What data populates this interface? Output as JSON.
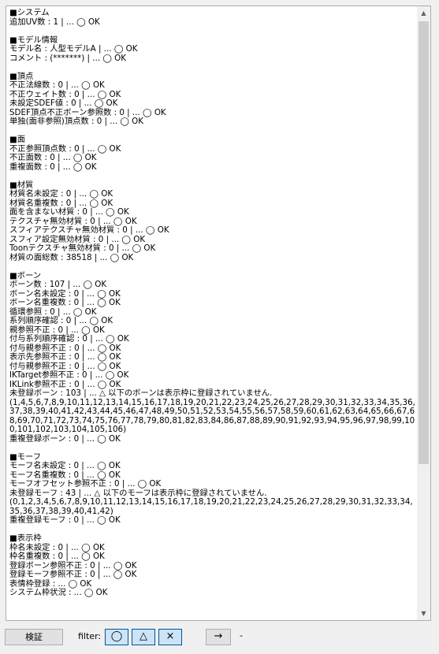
{
  "report": {
    "lines": [
      "■システム",
      "追加UV数 : 1 | ... ◯ OK",
      "",
      "■モデル情報",
      "モデル名 : 人型モデルA | ... ◯ OK",
      "コメント : (*******) | ... ◯ OK",
      "",
      "■頂点",
      "不正法線数 : 0 | ... ◯ OK",
      "不正ウェイト数 : 0 | ... ◯ OK",
      "未設定SDEF値 : 0 | ... ◯ OK",
      "SDEF頂点不正ボーン参照数 : 0 | ... ◯ OK",
      "単独(面非参照)頂点数 : 0 | ... ◯ OK",
      "",
      "■面",
      "不正参照頂点数 : 0 | ... ◯ OK",
      "不正面数 : 0 | ... ◯ OK",
      "重複面数 : 0 | ... ◯ OK",
      "",
      "■材質",
      "材質名未設定 : 0 | ... ◯ OK",
      "材質名重複数 : 0 | ... ◯ OK",
      "面を含まない材質 : 0 | ... ◯ OK",
      "テクスチャ無効材質 : 0 | ... ◯ OK",
      "スフィアテクスチャ無効材質 : 0 | ... ◯ OK",
      "スフィア設定無効材質 : 0 | ... ◯ OK",
      "Toonテクスチャ無効材質 : 0 | ... ◯ OK",
      "材質の面総数 : 38518 | ... ◯ OK",
      "",
      "■ボーン",
      "ボーン数 : 107 | ... ◯ OK",
      "ボーン名未設定 : 0 | ... ◯ OK",
      "ボーン名重複数 : 0 | ... ◯ OK",
      "循環参照 : 0 | ... ◯ OK",
      "系列順序確認 : 0 | ... ◯ OK",
      "親参照不正 : 0 | ... ◯ OK",
      "付与系列順序確認 : 0 | ... ◯ OK",
      "付与親参照不正 : 0 | ... ◯ OK",
      "表示先参照不正 : 0 | ... ◯ OK",
      "付与親参照不正 : 0 | ... ◯ OK",
      "IKTarget参照不正 : 0 | ... ◯ OK",
      "IKLink参照不正 : 0 | ... ◯ OK",
      "未登録ボーン : 103 | ... △ 以下のボーンは表示枠に登録されていません.",
      "(1,4,5,6,7,8,9,10,11,12,13,14,15,16,17,18,19,20,21,22,23,24,25,26,27,28,29,30,31,32,33,34,35,36,37,38,39,40,41,42,43,44,45,46,47,48,49,50,51,52,53,54,55,56,57,58,59,60,61,62,63,64,65,66,67,68,69,70,71,72,73,74,75,76,77,78,79,80,81,82,83,84,86,87,88,89,90,91,92,93,94,95,96,97,98,99,100,101,102,103,104,105,106)",
      "重複登録ボーン : 0 | ... ◯ OK",
      "",
      "■モーフ",
      "モーフ名未設定 : 0 | ... ◯ OK",
      "モーフ名重複数 : 0 | ... ◯ OK",
      "モーフオフセット参照不正 : 0 | ... ◯ OK",
      "未登録モーフ : 43 | ... △ 以下のモーフは表示枠に登録されていません.",
      "(0,1,2,3,4,5,6,7,8,9,10,11,12,13,14,15,16,17,18,19,20,21,22,23,24,25,26,27,28,29,30,31,32,33,34,35,36,37,38,39,40,41,42)",
      "重複登録モーフ : 0 | ... ◯ OK",
      "",
      "■表示枠",
      "枠名未設定 : 0 | ... ◯ OK",
      "枠名重複数 : 0 | ... ◯ OK",
      "登録ボーン参照不正 : 0 | ... ◯ OK",
      "登録モーフ参照不正 : 0 | ... ◯ OK",
      "表情枠登録 : ... ◯ OK",
      "システム枠状況 : ... ◯ OK"
    ]
  },
  "toolbar": {
    "verify_label": "検証",
    "filter_label": "filter:",
    "filter_circle": "◯",
    "filter_triangle": "△",
    "filter_cross": "×",
    "next_label": "→",
    "status": "-"
  },
  "scrollbar": {
    "up_arrow": "▲",
    "down_arrow": "▼"
  }
}
